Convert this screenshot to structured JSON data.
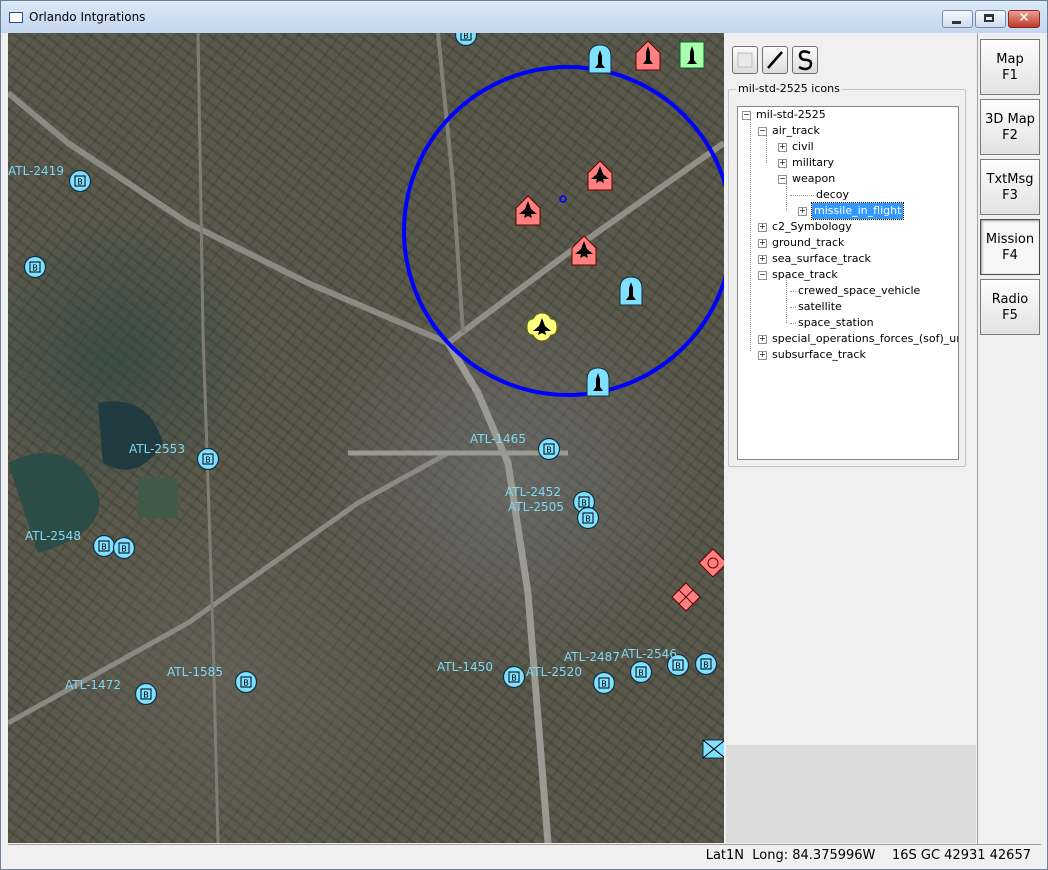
{
  "window": {
    "title": "Orlando Intgrations"
  },
  "toolbar": {
    "square_icon": "square-icon",
    "line_icon": "line-icon",
    "curve_icon": "curve-icon"
  },
  "icons_panel": {
    "group_title": "mil-std-2525 icons",
    "tree": {
      "root": "mil-std-2525",
      "air_track": "air_track",
      "civil": "civil",
      "military": "military",
      "weapon": "weapon",
      "decoy": "decoy",
      "missile_in_flight": "missile_in_flight",
      "c2_symbology": "c2_Symbology",
      "ground_track": "ground_track",
      "sea_surface_track": "sea_surface_track",
      "space_track": "space_track",
      "crewed_space_vehicle": "crewed_space_vehicle",
      "satellite": "satellite",
      "space_station": "space_station",
      "sof_unit": "special_operations_forces_(sof)_unit",
      "subsurface_track": "subsurface_track"
    }
  },
  "sidebar": {
    "tabs": [
      {
        "name": "Map",
        "key": "F1"
      },
      {
        "name": "3D Map",
        "key": "F2"
      },
      {
        "name": "TxtMsg",
        "key": "F3"
      },
      {
        "name": "Mission",
        "key": "F4"
      },
      {
        "name": "Radio",
        "key": "F5"
      }
    ]
  },
  "map": {
    "labels": {
      "atl2419": "ATL-2419",
      "atl2553": "ATL-2553",
      "atl1465": "ATL-1465",
      "atl2452": "ATL-2452",
      "atl2505": "ATL-2505",
      "atl2548": "ATL-2548",
      "atl1450": "ATL-1450",
      "atl1585": "ATL-1585",
      "atl1472": "ATL-1472",
      "atl2520": "ATL-2520",
      "atl2487": "ATL-2487",
      "atl2546": "ATL-2546"
    },
    "track_symbol_letter": "B",
    "colors": {
      "friend": "#80e0ff",
      "hostile": "#ff8080",
      "unknown": "#ffff80",
      "neutral": "#aaffaa",
      "range_ring": "#0000ff"
    }
  },
  "status": {
    "position": "Lat1N  Long: 84.375996W    16S GC 42931 42657"
  }
}
